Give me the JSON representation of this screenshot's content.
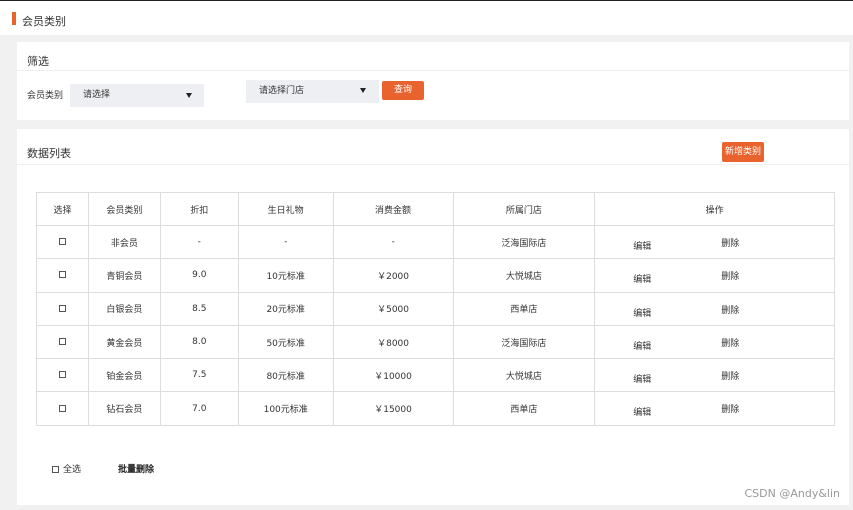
{
  "header": {
    "title": "会员类别"
  },
  "filter": {
    "title": "筛选",
    "member_label": "会员类别",
    "member_select": "请选择",
    "store_select": "请选择门店",
    "query_button": "查询"
  },
  "list": {
    "title": "数据列表",
    "add_button": "新增类别",
    "columns": [
      "选择",
      "会员类别",
      "折扣",
      "生日礼物",
      "消费金额",
      "所属门店",
      "操作"
    ],
    "rows": [
      {
        "type": "非会员",
        "discount": "-",
        "gift": "-",
        "amount": "-",
        "store": "泛海国际店",
        "edit": "编辑",
        "delete": "删除"
      },
      {
        "type": "青铜会员",
        "discount": "9.0",
        "gift": "10元标准",
        "amount": "￥2000",
        "store": "大悦城店",
        "edit": "编辑",
        "delete": "删除"
      },
      {
        "type": "白银会员",
        "discount": "8.5",
        "gift": "20元标准",
        "amount": "￥5000",
        "store": "西单店",
        "edit": "编辑",
        "delete": "删除"
      },
      {
        "type": "黄金会员",
        "discount": "8.0",
        "gift": "50元标准",
        "amount": "￥8000",
        "store": "泛海国际店",
        "edit": "编辑",
        "delete": "删除"
      },
      {
        "type": "铂金会员",
        "discount": "7.5",
        "gift": "80元标准",
        "amount": "￥10000",
        "store": "大悦城店",
        "edit": "编辑",
        "delete": "删除"
      },
      {
        "type": "钻石会员",
        "discount": "7.0",
        "gift": "100元标准",
        "amount": "￥15000",
        "store": "西单店",
        "edit": "编辑",
        "delete": "删除"
      }
    ],
    "select_all": "全选",
    "batch_delete": "批量删除"
  },
  "watermark": "CSDN @Andy&lin",
  "colors": {
    "accent": "#e8632e"
  }
}
